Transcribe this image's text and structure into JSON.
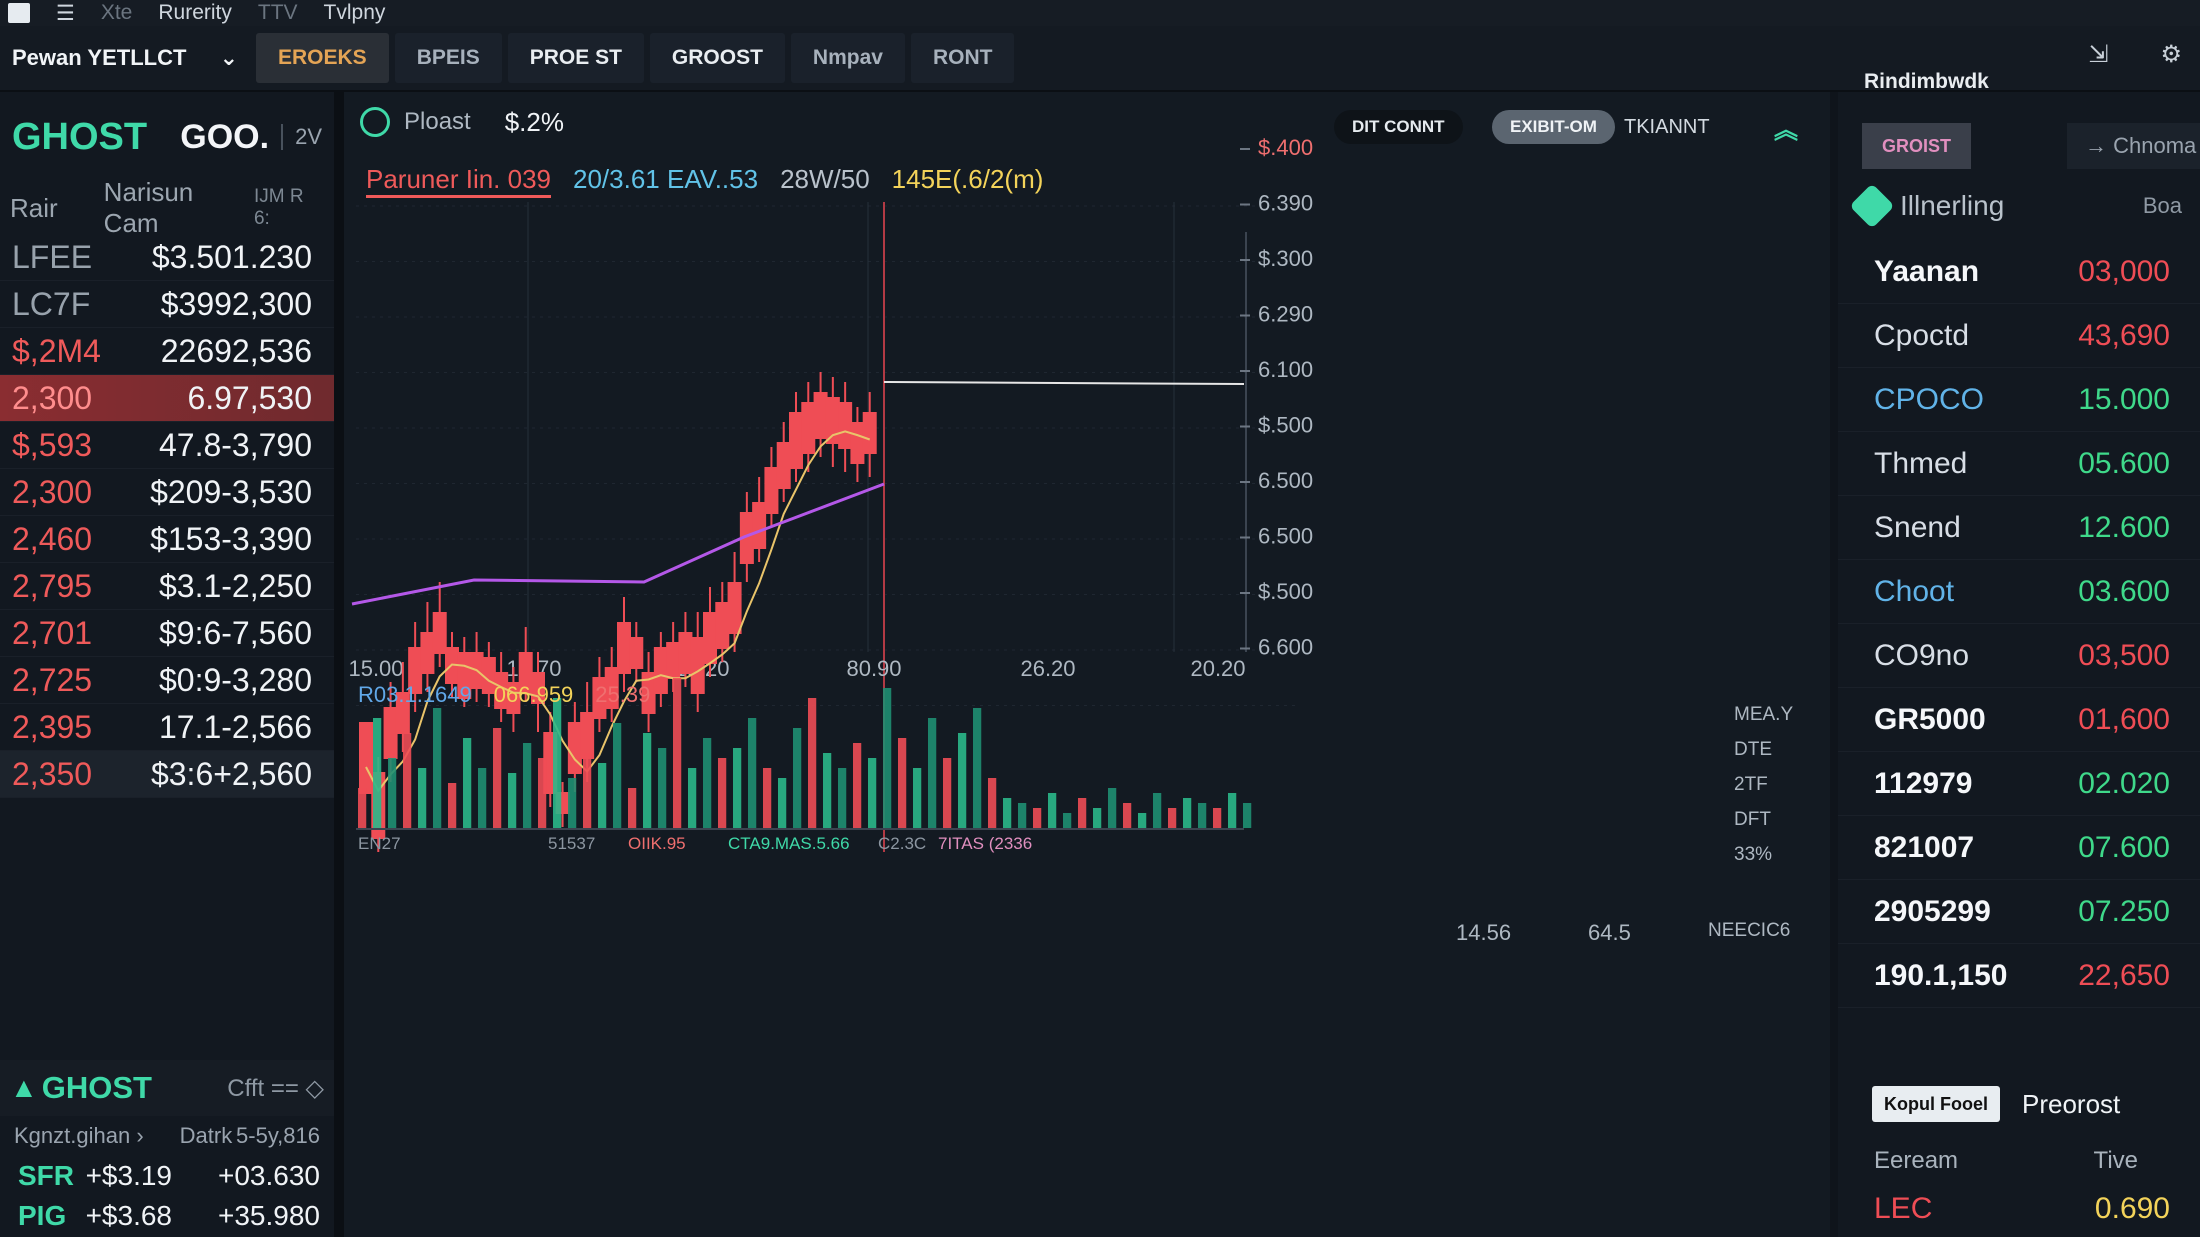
{
  "menubar": {
    "item1": "Xte",
    "item2": "Rurerity",
    "item3": "TTV",
    "item4": "Tvlpny"
  },
  "account": {
    "name": "Pewan YETLLCT"
  },
  "tabs": [
    "EROEKS",
    "BPEIS",
    "PROE ST",
    "GROOST",
    "Nmpav",
    "RONT"
  ],
  "left": {
    "symbol": "GHOST",
    "price": "GOO.",
    "change": "2V",
    "col1": "Rair",
    "col2": "Narisun Cam",
    "col3": "IJM R 6:",
    "rows": [
      {
        "a": "LFEE",
        "b": "$3.50",
        "c": "1.230",
        "style": "gray"
      },
      {
        "a": "LC7F",
        "b": "$399",
        "c": "2,300",
        "style": "gray"
      },
      {
        "a": "$,2M4",
        "b": "2269",
        "c": "2,536",
        "style": "red"
      },
      {
        "a": "2,300",
        "b": "6.9",
        "c": "7,530",
        "style": "hl"
      },
      {
        "a": "$,593",
        "b": "47.8",
        "c": "-3,790",
        "style": "red"
      },
      {
        "a": "2,300",
        "b": "$209",
        "c": "-3,530",
        "style": "red"
      },
      {
        "a": "2,460",
        "b": "$153",
        "c": "-3,390",
        "style": "red"
      },
      {
        "a": "2,795",
        "b": "$3.1",
        "c": "-2,250",
        "style": "red"
      },
      {
        "a": "2,701",
        "b": "$9:6",
        "c": "-7,560",
        "style": "red"
      },
      {
        "a": "2,725",
        "b": "$0:9",
        "c": "-3,280",
        "style": "red"
      },
      {
        "a": "2,395",
        "b": "17.1",
        "c": "-2,566",
        "style": "red"
      },
      {
        "a": "2,350",
        "b": "$3:6",
        "c": "+2,560",
        "style": "red last"
      }
    ],
    "sub": {
      "symbol": "GHOST",
      "option": "Cfft ==",
      "h1": "Kgnzt.gihan",
      "h2": "Datrk",
      "h3": "5-5y,816",
      "rows": [
        {
          "s": "SFR",
          "v": "+$3.19",
          "c": "+03.630"
        },
        {
          "s": "PIG",
          "v": "+$3.68",
          "c": "+35.980"
        }
      ]
    }
  },
  "chart_top": {
    "label": "Ploast",
    "pct": "$.2%",
    "chip1": "DIT CONNT",
    "chip2": "EXIBIT-OM",
    "chip3": "TKIANNT"
  },
  "chart_legend": {
    "l1": "Paruner Iin. 039",
    "l2": "20/3.61 EAV..53",
    "l3": "28W/50",
    "l4": "145E(.6/2(m)"
  },
  "vol_legend": {
    "v1": "R03.1.1649",
    "v2": "066.959",
    "v3": "25.39"
  },
  "vol_right": [
    "MEA.Y",
    "DTE",
    "2TF",
    "DFT",
    "33%"
  ],
  "vol_axis": [
    "EN27",
    "51537",
    "OIIK.95",
    "CTA9.MAS.5.66",
    "C2.3C",
    "7ITAS (2336"
  ],
  "footer": [
    "14.56",
    "64.5",
    "NEECIC6"
  ],
  "chart_data": {
    "type": "candlestick",
    "x_labels": [
      "15.00",
      "15.70",
      "15.20",
      "80.90",
      "26.20",
      "20.20"
    ],
    "y_labels": [
      "$.400",
      "6.390",
      "$.300",
      "6.290",
      "6.100",
      "$.500",
      "6.500",
      "6.500",
      "$.500",
      "6.600"
    ],
    "colors": {
      "up": "#2fe37f",
      "down": "#ef4d55",
      "ma1": "#e9c46a",
      "ma2": "#b458e8"
    },
    "candles": [
      {
        "o": 630,
        "c": 700,
        "h": 645,
        "l": 700
      },
      {
        "o": 680,
        "c": 745,
        "h": 665,
        "l": 760
      },
      {
        "o": 615,
        "c": 665,
        "h": 590,
        "l": 690
      },
      {
        "o": 600,
        "c": 640,
        "h": 570,
        "l": 660
      },
      {
        "o": 555,
        "c": 600,
        "h": 530,
        "l": 620
      },
      {
        "o": 540,
        "c": 580,
        "h": 510,
        "l": 600
      },
      {
        "o": 520,
        "c": 560,
        "h": 490,
        "l": 575
      },
      {
        "o": 555,
        "c": 590,
        "h": 540,
        "l": 605
      },
      {
        "o": 560,
        "c": 605,
        "h": 545,
        "l": 615
      },
      {
        "o": 560,
        "c": 595,
        "h": 540,
        "l": 610
      },
      {
        "o": 565,
        "c": 600,
        "h": 550,
        "l": 615
      },
      {
        "o": 580,
        "c": 615,
        "h": 560,
        "l": 630
      },
      {
        "o": 590,
        "c": 620,
        "h": 575,
        "l": 640
      },
      {
        "o": 560,
        "c": 600,
        "h": 535,
        "l": 610
      },
      {
        "o": 580,
        "c": 610,
        "h": 560,
        "l": 640
      },
      {
        "o": 640,
        "c": 700,
        "h": 620,
        "l": 715
      },
      {
        "o": 700,
        "c": 720,
        "h": 690,
        "l": 735
      },
      {
        "o": 630,
        "c": 680,
        "h": 610,
        "l": 700
      },
      {
        "o": 620,
        "c": 665,
        "h": 590,
        "l": 690
      },
      {
        "o": 585,
        "c": 625,
        "h": 565,
        "l": 640
      },
      {
        "o": 575,
        "c": 615,
        "h": 555,
        "l": 630
      },
      {
        "o": 530,
        "c": 580,
        "h": 505,
        "l": 600
      },
      {
        "o": 545,
        "c": 575,
        "h": 530,
        "l": 590
      },
      {
        "o": 580,
        "c": 620,
        "h": 560,
        "l": 640
      },
      {
        "o": 555,
        "c": 600,
        "h": 540,
        "l": 615
      },
      {
        "o": 550,
        "c": 585,
        "h": 530,
        "l": 600
      },
      {
        "o": 540,
        "c": 580,
        "h": 520,
        "l": 595
      },
      {
        "o": 545,
        "c": 600,
        "h": 520,
        "l": 620
      },
      {
        "o": 520,
        "c": 570,
        "h": 495,
        "l": 585
      },
      {
        "o": 510,
        "c": 555,
        "h": 490,
        "l": 570
      },
      {
        "o": 490,
        "c": 540,
        "h": 460,
        "l": 560
      },
      {
        "o": 420,
        "c": 470,
        "h": 400,
        "l": 490
      },
      {
        "o": 410,
        "c": 455,
        "h": 385,
        "l": 470
      },
      {
        "o": 375,
        "c": 420,
        "h": 355,
        "l": 435
      },
      {
        "o": 350,
        "c": 395,
        "h": 330,
        "l": 410
      },
      {
        "o": 320,
        "c": 375,
        "h": 300,
        "l": 390
      },
      {
        "o": 310,
        "c": 360,
        "h": 290,
        "l": 380
      },
      {
        "o": 300,
        "c": 345,
        "h": 280,
        "l": 365
      },
      {
        "o": 305,
        "c": 350,
        "h": 285,
        "l": 375
      },
      {
        "o": 310,
        "c": 355,
        "h": 290,
        "l": 380
      },
      {
        "o": 330,
        "c": 370,
        "h": 315,
        "l": 390
      },
      {
        "o": 320,
        "c": 360,
        "h": 300,
        "l": 385
      }
    ],
    "volume": [
      40,
      110,
      70,
      95,
      60,
      120,
      45,
      90,
      60,
      100,
      55,
      85,
      70,
      130,
      50,
      75,
      65,
      105,
      40,
      95,
      80,
      150,
      60,
      90,
      70,
      80,
      110,
      60,
      50,
      100,
      130,
      75,
      60,
      85,
      70,
      140,
      90,
      60,
      110,
      70,
      95,
      120,
      50,
      30,
      25,
      20,
      35,
      15,
      30,
      20,
      40,
      25,
      15,
      35,
      20,
      30,
      25,
      20,
      35,
      25
    ]
  },
  "right": {
    "title": "Rindimbwdk",
    "tab1": "GROIST",
    "tab2": "Chnoma",
    "head": "Illnerling",
    "head_x": "Boa",
    "rows": [
      {
        "n": "Yaanan",
        "v": "03,000",
        "ns": "w",
        "vs": "r"
      },
      {
        "n": "Cpoctd",
        "v": "43,690",
        "ns": "",
        "vs": "r"
      },
      {
        "n": "CPOCO",
        "v": "15.000",
        "ns": "b",
        "vs": "g"
      },
      {
        "n": "Thmed",
        "v": "05.600",
        "ns": "",
        "vs": "g"
      },
      {
        "n": "Snend",
        "v": "12.600",
        "ns": "",
        "vs": "g"
      },
      {
        "n": "Choot",
        "v": "03.600",
        "ns": "b",
        "vs": "g"
      },
      {
        "n": "CO9no",
        "v": "03,500",
        "ns": "",
        "vs": "r"
      },
      {
        "n": "GR5000",
        "v": "01,600",
        "ns": "w",
        "vs": "r"
      },
      {
        "n": "112979",
        "v": "02.020",
        "ns": "w",
        "vs": "g"
      },
      {
        "n": "821007",
        "v": "07.600",
        "ns": "w",
        "vs": "g"
      },
      {
        "n": "2905299",
        "v": "07.250",
        "ns": "w",
        "vs": "g"
      },
      {
        "n": "190.1,150",
        "v": "22,650",
        "ns": "w",
        "vs": "r"
      }
    ],
    "bottom": {
      "btn": "Kopul Fooel",
      "pre": "Preorost",
      "h1": "Eeream",
      "h2": "Tive",
      "row": {
        "s": "LEC",
        "v": "0.690"
      }
    }
  }
}
